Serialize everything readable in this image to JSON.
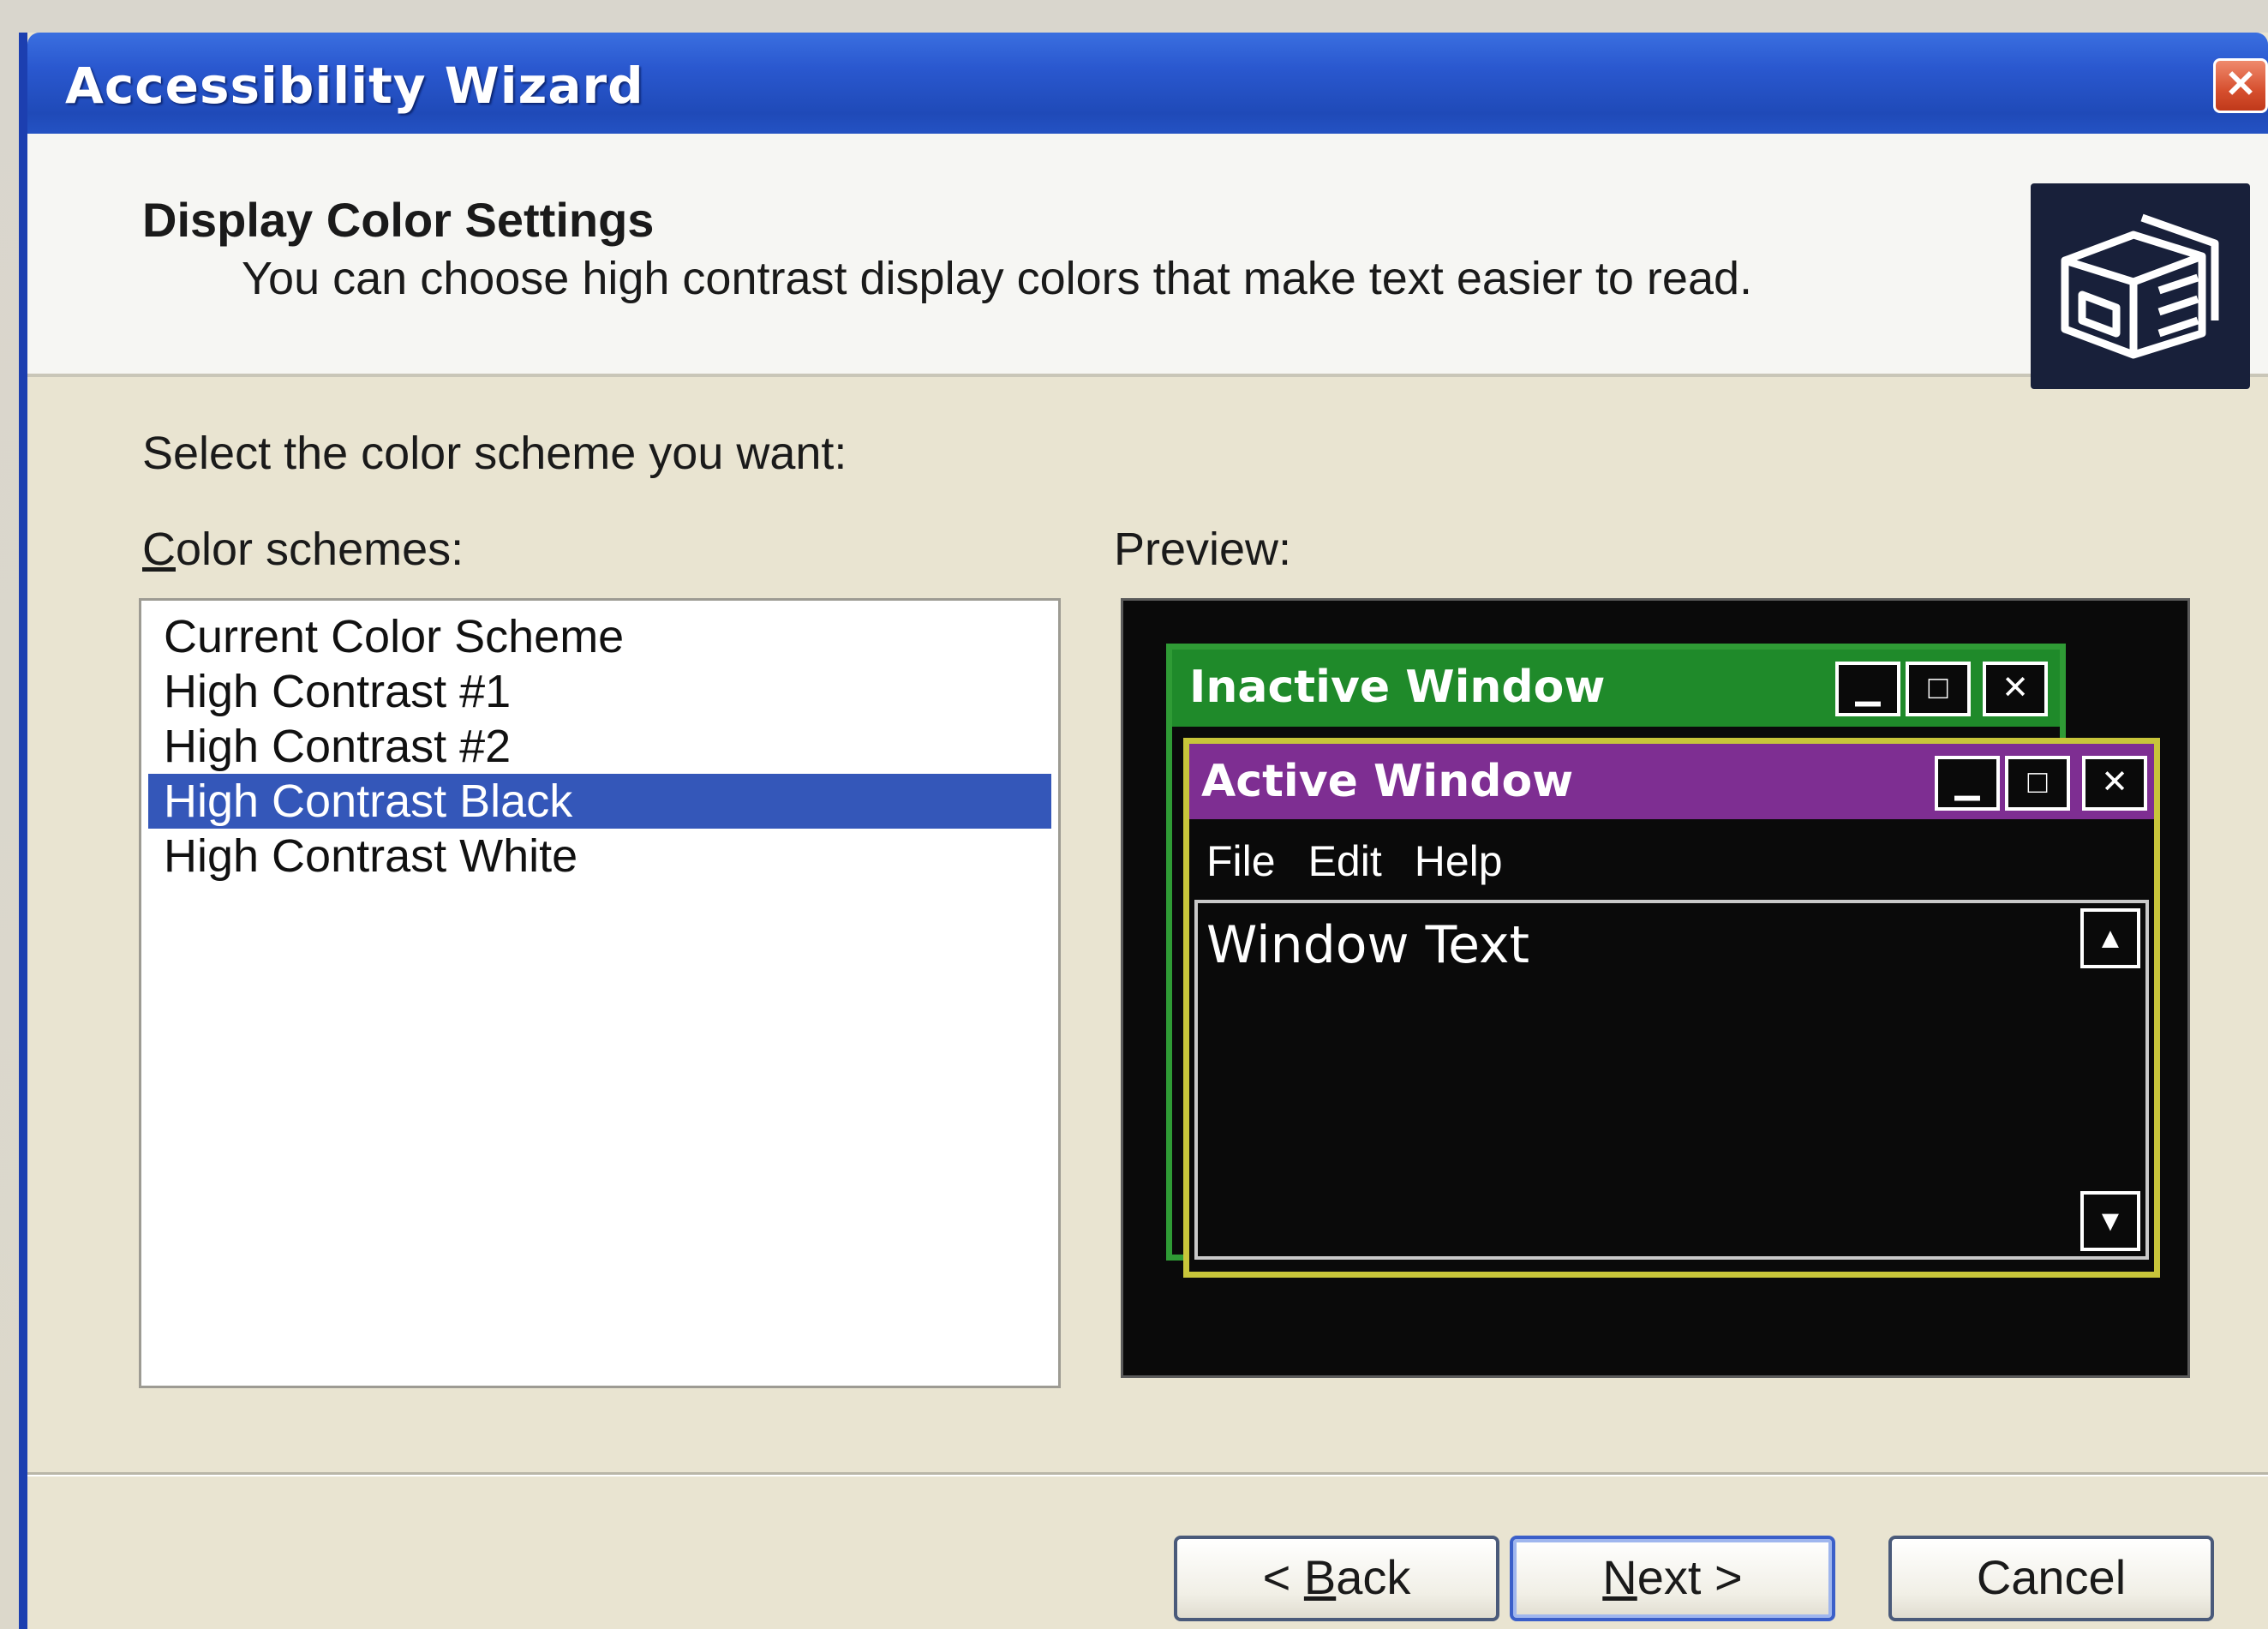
{
  "window": {
    "title": "Accessibility Wizard"
  },
  "header": {
    "title": "Display Color Settings",
    "subtitle": "You can choose high contrast display colors that make text easier to read.",
    "icon": "accessibility-wizard-icon"
  },
  "body": {
    "prompt": "Select the color scheme you want:",
    "schemes_label_mnemonic": "C",
    "schemes_label_rest": "olor schemes:",
    "preview_label": "Preview:",
    "color_schemes": [
      {
        "label": "Current Color Scheme",
        "selected": false
      },
      {
        "label": "High Contrast #1",
        "selected": false
      },
      {
        "label": "High Contrast #2",
        "selected": false
      },
      {
        "label": "High Contrast Black",
        "selected": true
      },
      {
        "label": "High Contrast White",
        "selected": false
      }
    ]
  },
  "preview": {
    "inactive_title": "Inactive Window",
    "active_title": "Active Window",
    "menu": [
      "File",
      "Edit",
      "Help"
    ],
    "window_text": "Window Text",
    "colors": {
      "inactive_titlebar": "#1f8a2a",
      "active_titlebar": "#7e2e92",
      "active_border": "#c8c53a",
      "background": "#0a0a0a"
    }
  },
  "footer": {
    "back_prefix": "< ",
    "back_mnemonic": "B",
    "back_rest": "ack",
    "next_mnemonic": "N",
    "next_rest": "ext >",
    "cancel_label": "Cancel"
  },
  "colors": {
    "titlebar": "#2452c3",
    "selection": "#3457b9"
  }
}
